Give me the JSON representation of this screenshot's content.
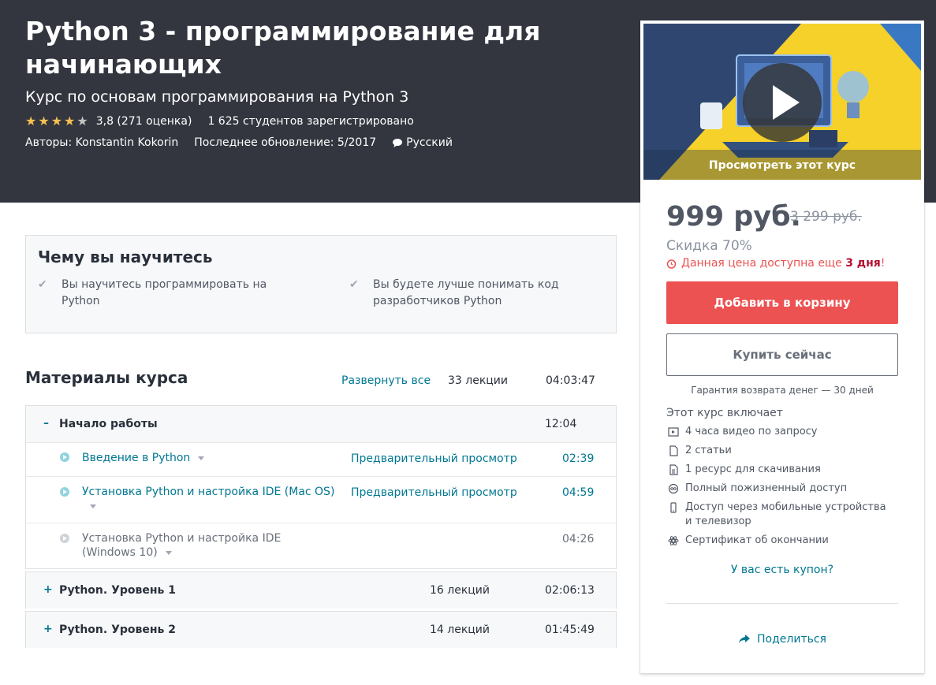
{
  "hero": {
    "title": "Python 3 - программирование для начинающих",
    "subtitle": "Курс по основам программирования на Python 3",
    "rating_value": 3.8,
    "rating_text": "3,8 (271 оценка)",
    "students": "1 625 студентов зарегистрировано",
    "authors": "Авторы: Konstantin Kokorin",
    "updated": "Последнее обновление: 5/2017",
    "language": "Русский",
    "colors": {
      "background": "#33363f",
      "star": "#f4c150"
    }
  },
  "learn": {
    "title": "Чему вы научитесь",
    "items": [
      "Вы научитесь программировать на Python",
      "Вы будете лучше понимать код разработчиков Python"
    ]
  },
  "curriculum": {
    "title": "Материалы курса",
    "expand_all": "Развернуть все",
    "lecture_count": "33 лекции",
    "total_duration": "04:03:47",
    "sections": [
      {
        "sign": "–",
        "name": "Начало работы",
        "count": "",
        "duration": "12:04",
        "lectures": [
          {
            "title": "Введение в Python",
            "preview": "Предварительный просмотр",
            "duration": "02:39",
            "previewable": true
          },
          {
            "title": "Установка Python и настройка IDE (Mac OS)",
            "preview": "Предварительный просмотр",
            "duration": "04:59",
            "previewable": true
          },
          {
            "title": "Установка Python и настройка IDE (Windows 10)",
            "preview": "",
            "duration": "04:26",
            "previewable": false
          }
        ]
      },
      {
        "sign": "+",
        "name": "Python. Уровень 1",
        "count": "16 лекций",
        "duration": "02:06:13",
        "lectures": []
      },
      {
        "sign": "+",
        "name": "Python. Уровень 2",
        "count": "14 лекций",
        "duration": "01:45:49",
        "lectures": []
      }
    ]
  },
  "sidebar": {
    "video_label": "Просмотреть этот курс",
    "price": "999 руб.",
    "old_price": "3 299 руб.",
    "discount": "Скидка 70%",
    "timer_text": "Данная цена доступна еще",
    "timer_days": "3 дня",
    "timer_suffix": "!",
    "add_to_cart": "Добавить в корзину",
    "buy_now": "Купить сейчас",
    "guarantee": "Гарантия возврата денег — 30 дней",
    "includes_title": "Этот курс включает",
    "includes": [
      {
        "icon": "video-icon",
        "text": "4 часа видео по запросу"
      },
      {
        "icon": "file-icon",
        "text": "2 статьи"
      },
      {
        "icon": "download-file-icon",
        "text": "1 ресурс для скачивания"
      },
      {
        "icon": "infinity-icon",
        "text": "Полный пожизненный доступ"
      },
      {
        "icon": "mobile-icon",
        "text": "Доступ через мобильные устройства и телевизор"
      },
      {
        "icon": "certificate-icon",
        "text": "Сертификат об окончании"
      }
    ],
    "coupon": "У вас есть купон?",
    "share": "Поделиться",
    "colors": {
      "accent_red": "#ec5252",
      "link": "#007791"
    }
  }
}
